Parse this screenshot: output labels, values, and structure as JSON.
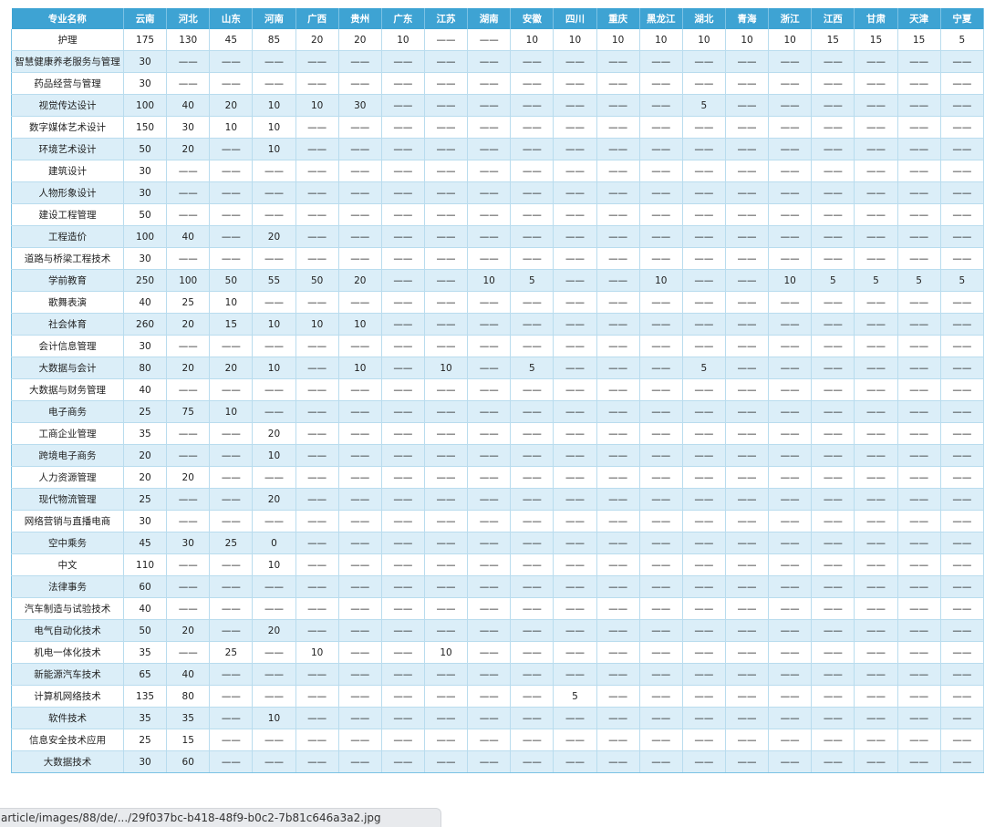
{
  "table": {
    "headers": [
      "专业名称",
      "云南",
      "河北",
      "山东",
      "河南",
      "广西",
      "贵州",
      "广东",
      "江苏",
      "湖南",
      "安徽",
      "四川",
      "重庆",
      "黑龙江",
      "湖北",
      "青海",
      "浙江",
      "江西",
      "甘肃",
      "天津",
      "宁夏"
    ],
    "rows": [
      [
        "护理",
        "175",
        "130",
        "45",
        "85",
        "20",
        "20",
        "10",
        "——",
        "——",
        "10",
        "10",
        "10",
        "10",
        "10",
        "10",
        "10",
        "15",
        "15",
        "15",
        "5"
      ],
      [
        "智慧健康养老服务与管理",
        "30",
        "——",
        "——",
        "——",
        "——",
        "——",
        "——",
        "——",
        "——",
        "——",
        "——",
        "——",
        "——",
        "——",
        "——",
        "——",
        "——",
        "——",
        "——",
        "——"
      ],
      [
        "药品经营与管理",
        "30",
        "——",
        "——",
        "——",
        "——",
        "——",
        "——",
        "——",
        "——",
        "——",
        "——",
        "——",
        "——",
        "——",
        "——",
        "——",
        "——",
        "——",
        "——",
        "——"
      ],
      [
        "视觉传达设计",
        "100",
        "40",
        "20",
        "10",
        "10",
        "30",
        "——",
        "——",
        "——",
        "——",
        "——",
        "——",
        "——",
        "5",
        "——",
        "——",
        "——",
        "——",
        "——",
        "——"
      ],
      [
        "数字媒体艺术设计",
        "150",
        "30",
        "10",
        "10",
        "——",
        "——",
        "——",
        "——",
        "——",
        "——",
        "——",
        "——",
        "——",
        "——",
        "——",
        "——",
        "——",
        "——",
        "——",
        "——"
      ],
      [
        "环境艺术设计",
        "50",
        "20",
        "——",
        "10",
        "——",
        "——",
        "——",
        "——",
        "——",
        "——",
        "——",
        "——",
        "——",
        "——",
        "——",
        "——",
        "——",
        "——",
        "——",
        "——"
      ],
      [
        "建筑设计",
        "30",
        "——",
        "——",
        "——",
        "——",
        "——",
        "——",
        "——",
        "——",
        "——",
        "——",
        "——",
        "——",
        "——",
        "——",
        "——",
        "——",
        "——",
        "——",
        "——"
      ],
      [
        "人物形象设计",
        "30",
        "——",
        "——",
        "——",
        "——",
        "——",
        "——",
        "——",
        "——",
        "——",
        "——",
        "——",
        "——",
        "——",
        "——",
        "——",
        "——",
        "——",
        "——",
        "——"
      ],
      [
        "建设工程管理",
        "50",
        "——",
        "——",
        "——",
        "——",
        "——",
        "——",
        "——",
        "——",
        "——",
        "——",
        "——",
        "——",
        "——",
        "——",
        "——",
        "——",
        "——",
        "——",
        "——"
      ],
      [
        "工程造价",
        "100",
        "40",
        "——",
        "20",
        "——",
        "——",
        "——",
        "——",
        "——",
        "——",
        "——",
        "——",
        "——",
        "——",
        "——",
        "——",
        "——",
        "——",
        "——",
        "——"
      ],
      [
        "道路与桥梁工程技术",
        "30",
        "——",
        "——",
        "——",
        "——",
        "——",
        "——",
        "——",
        "——",
        "——",
        "——",
        "——",
        "——",
        "——",
        "——",
        "——",
        "——",
        "——",
        "——",
        "——"
      ],
      [
        "学前教育",
        "250",
        "100",
        "50",
        "55",
        "50",
        "20",
        "——",
        "——",
        "10",
        "5",
        "——",
        "——",
        "10",
        "——",
        "——",
        "10",
        "5",
        "5",
        "5",
        "5"
      ],
      [
        "歌舞表演",
        "40",
        "25",
        "10",
        "——",
        "——",
        "——",
        "——",
        "——",
        "——",
        "——",
        "——",
        "——",
        "——",
        "——",
        "——",
        "——",
        "——",
        "——",
        "——",
        "——"
      ],
      [
        "社会体育",
        "260",
        "20",
        "15",
        "10",
        "10",
        "10",
        "——",
        "——",
        "——",
        "——",
        "——",
        "——",
        "——",
        "——",
        "——",
        "——",
        "——",
        "——",
        "——",
        "——"
      ],
      [
        "会计信息管理",
        "30",
        "——",
        "——",
        "——",
        "——",
        "——",
        "——",
        "——",
        "——",
        "——",
        "——",
        "——",
        "——",
        "——",
        "——",
        "——",
        "——",
        "——",
        "——",
        "——"
      ],
      [
        "大数据与会计",
        "80",
        "20",
        "20",
        "10",
        "——",
        "10",
        "——",
        "10",
        "——",
        "5",
        "——",
        "——",
        "——",
        "5",
        "——",
        "——",
        "——",
        "——",
        "——",
        "——"
      ],
      [
        "大数据与财务管理",
        "40",
        "——",
        "——",
        "——",
        "——",
        "——",
        "——",
        "——",
        "——",
        "——",
        "——",
        "——",
        "——",
        "——",
        "——",
        "——",
        "——",
        "——",
        "——",
        "——"
      ],
      [
        "电子商务",
        "25",
        "75",
        "10",
        "——",
        "——",
        "——",
        "——",
        "——",
        "——",
        "——",
        "——",
        "——",
        "——",
        "——",
        "——",
        "——",
        "——",
        "——",
        "——",
        "——"
      ],
      [
        "工商企业管理",
        "35",
        "——",
        "——",
        "20",
        "——",
        "——",
        "——",
        "——",
        "——",
        "——",
        "——",
        "——",
        "——",
        "——",
        "——",
        "——",
        "——",
        "——",
        "——",
        "——"
      ],
      [
        "跨境电子商务",
        "20",
        "——",
        "——",
        "10",
        "——",
        "——",
        "——",
        "——",
        "——",
        "——",
        "——",
        "——",
        "——",
        "——",
        "——",
        "——",
        "——",
        "——",
        "——",
        "——"
      ],
      [
        "人力资源管理",
        "20",
        "20",
        "——",
        "——",
        "——",
        "——",
        "——",
        "——",
        "——",
        "——",
        "——",
        "——",
        "——",
        "——",
        "——",
        "——",
        "——",
        "——",
        "——",
        "——"
      ],
      [
        "现代物流管理",
        "25",
        "——",
        "——",
        "20",
        "——",
        "——",
        "——",
        "——",
        "——",
        "——",
        "——",
        "——",
        "——",
        "——",
        "——",
        "——",
        "——",
        "——",
        "——",
        "——"
      ],
      [
        "网络营销与直播电商",
        "30",
        "——",
        "——",
        "——",
        "——",
        "——",
        "——",
        "——",
        "——",
        "——",
        "——",
        "——",
        "——",
        "——",
        "——",
        "——",
        "——",
        "——",
        "——",
        "——"
      ],
      [
        "空中乘务",
        "45",
        "30",
        "25",
        "0",
        "——",
        "——",
        "——",
        "——",
        "——",
        "——",
        "——",
        "——",
        "——",
        "——",
        "——",
        "——",
        "——",
        "——",
        "——",
        "——"
      ],
      [
        "中文",
        "110",
        "——",
        "——",
        "10",
        "——",
        "——",
        "——",
        "——",
        "——",
        "——",
        "——",
        "——",
        "——",
        "——",
        "——",
        "——",
        "——",
        "——",
        "——",
        "——"
      ],
      [
        "法律事务",
        "60",
        "——",
        "——",
        "——",
        "——",
        "——",
        "——",
        "——",
        "——",
        "——",
        "——",
        "——",
        "——",
        "——",
        "——",
        "——",
        "——",
        "——",
        "——",
        "——"
      ],
      [
        "汽车制造与试验技术",
        "40",
        "——",
        "——",
        "——",
        "——",
        "——",
        "——",
        "——",
        "——",
        "——",
        "——",
        "——",
        "——",
        "——",
        "——",
        "——",
        "——",
        "——",
        "——",
        "——"
      ],
      [
        "电气自动化技术",
        "50",
        "20",
        "——",
        "20",
        "——",
        "——",
        "——",
        "——",
        "——",
        "——",
        "——",
        "——",
        "——",
        "——",
        "——",
        "——",
        "——",
        "——",
        "——",
        "——"
      ],
      [
        "机电一体化技术",
        "35",
        "——",
        "25",
        "——",
        "10",
        "——",
        "——",
        "10",
        "——",
        "——",
        "——",
        "——",
        "——",
        "——",
        "——",
        "——",
        "——",
        "——",
        "——",
        "——"
      ],
      [
        "新能源汽车技术",
        "65",
        "40",
        "——",
        "——",
        "——",
        "——",
        "——",
        "——",
        "——",
        "——",
        "——",
        "——",
        "——",
        "——",
        "——",
        "——",
        "——",
        "——",
        "——",
        "——"
      ],
      [
        "计算机网络技术",
        "135",
        "80",
        "——",
        "——",
        "——",
        "——",
        "——",
        "——",
        "——",
        "——",
        "5",
        "——",
        "——",
        "——",
        "——",
        "——",
        "——",
        "——",
        "——",
        "——"
      ],
      [
        "软件技术",
        "35",
        "35",
        "——",
        "10",
        "——",
        "——",
        "——",
        "——",
        "——",
        "——",
        "——",
        "——",
        "——",
        "——",
        "——",
        "——",
        "——",
        "——",
        "——",
        "——"
      ],
      [
        "信息安全技术应用",
        "25",
        "15",
        "——",
        "——",
        "——",
        "——",
        "——",
        "——",
        "——",
        "——",
        "——",
        "——",
        "——",
        "——",
        "——",
        "——",
        "——",
        "——",
        "——",
        "——"
      ],
      [
        "大数据技术",
        "30",
        "60",
        "——",
        "——",
        "——",
        "——",
        "——",
        "——",
        "——",
        "——",
        "——",
        "——",
        "——",
        "——",
        "——",
        "——",
        "——",
        "——",
        "——",
        "——"
      ]
    ]
  },
  "status_url": "article/images/88/de/.../29f037bc-b418-48f9-b0c2-7b81c646a3a2.jpg",
  "colors": {
    "header_bg": "#3ea3d3",
    "row_alt_bg": "#dbeef8",
    "row_bg": "#ffffff",
    "border": "#b9dcee"
  }
}
